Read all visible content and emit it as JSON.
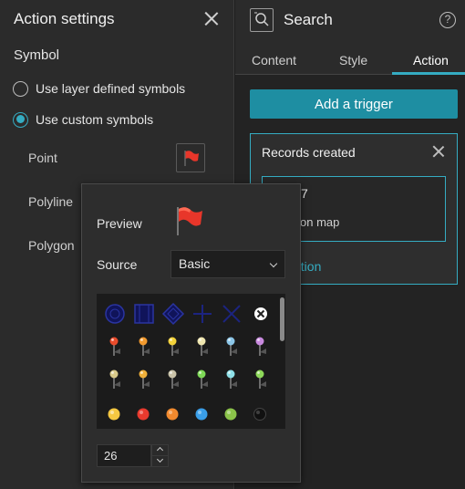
{
  "action_settings": {
    "title": "Action settings",
    "symbol_section": "Symbol",
    "radio_options": [
      {
        "label": "Use layer defined symbols",
        "checked": false
      },
      {
        "label": "Use custom symbols",
        "checked": true
      }
    ],
    "geometry_labels": [
      "Point",
      "Polyline",
      "Polygon"
    ]
  },
  "symbol_popover": {
    "preview_label": "Preview",
    "source_label": "Source",
    "source_value": "Basic",
    "size_value": "26",
    "symbol_rows": [
      [
        "shape-icon",
        "shape-icon",
        "shape-icon",
        "shape-icon",
        "shape-icon",
        "x-circle-icon"
      ],
      [
        "red-pin-icon",
        "orange-pin-icon",
        "yellow-pin-icon",
        "cream-pin-icon",
        "blue-pin-icon",
        "purple-pin-icon"
      ],
      [
        "tan-pin-icon",
        "orange-pin-icon",
        "gray-pin-icon",
        "green-pin-icon",
        "teal-pin-icon",
        "green-pin-icon"
      ],
      [
        "yellow-circle-icon",
        "red-circle-icon",
        "orange-circle-icon",
        "blue-circle-icon",
        "green-circle-icon",
        "black-circle-icon"
      ]
    ],
    "colors": {
      "pin_heads": [
        "#e94b2b",
        "#f29a2e",
        "#f3d23a",
        "#f0e7b0",
        "#8cc6e8",
        "#c98adf"
      ],
      "pin_heads_row2": [
        "#d8c98a",
        "#f0b03a",
        "#c9c2a8",
        "#7ed957",
        "#8ee0e8",
        "#8ed95a"
      ],
      "circles": [
        "#f5c842",
        "#e83a2e",
        "#f28a2e",
        "#3a9ee8",
        "#8bc34a",
        "#111111"
      ]
    }
  },
  "search_widget": {
    "title": "Search",
    "tabs": [
      "Content",
      "Style",
      "Action"
    ],
    "active_tab": "Action",
    "add_trigger_label": "Add a trigger",
    "trigger_card_title": "Records created",
    "inner_count": "7",
    "inner_action": "w on map",
    "add_action_label": "action"
  },
  "accent_color": "#35acc2",
  "button_color": "#1e8ea2"
}
